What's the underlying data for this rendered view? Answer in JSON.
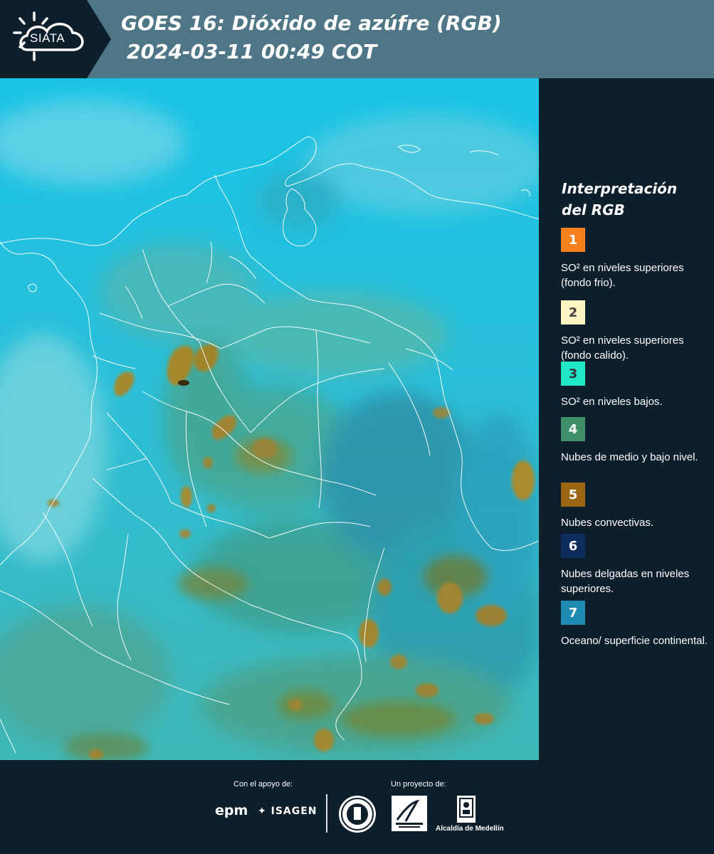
{
  "header": {
    "logo_text": "SIATA",
    "title_line1": "GOES 16: Dióxido de azúfre (RGB)",
    "title_line2": "2024-03-11 00:49 COT"
  },
  "legend": {
    "title_line1": "Interpretación",
    "title_line2": "del RGB",
    "items": [
      {
        "number": "1",
        "color": "#f47f1c",
        "text_color": "#ffffff",
        "description": "SO² en niveles superiores (fondo frio)."
      },
      {
        "number": "2",
        "color": "#fdf5c2",
        "text_color": "#444444",
        "description": "SO² en niveles superiores (fondo calido)."
      },
      {
        "number": "3",
        "color": "#20e8c6",
        "text_color": "#333333",
        "description": "SO² en niveles bajos."
      },
      {
        "number": "4",
        "color": "#3f8f6a",
        "text_color": "#ffffff",
        "description": "Nubes de medio y bajo nivel."
      },
      {
        "number": "5",
        "color": "#9a6614",
        "text_color": "#ffffff",
        "description": "Nubes convectivas."
      },
      {
        "number": "6",
        "color": "#0e2c5c",
        "text_color": "#ffffff",
        "description": "Nubes delgadas en niveles superiores."
      },
      {
        "number": "7",
        "color": "#1d8bb2",
        "text_color": "#ffffff",
        "description": "Oceano/ superficie continental."
      }
    ]
  },
  "footer": {
    "support_label": "Con el apoyo de:",
    "project_label": "Un proyecto de:",
    "sponsor1": "epm",
    "sponsor2": "ISAGEN",
    "partner3": "Alcaldía de Medellín"
  },
  "map": {
    "ocean_color": "#1ec3dc",
    "land_color": "#3a9e8c",
    "convective_color": "#9c8a2e",
    "border_color": "#ffffff"
  }
}
